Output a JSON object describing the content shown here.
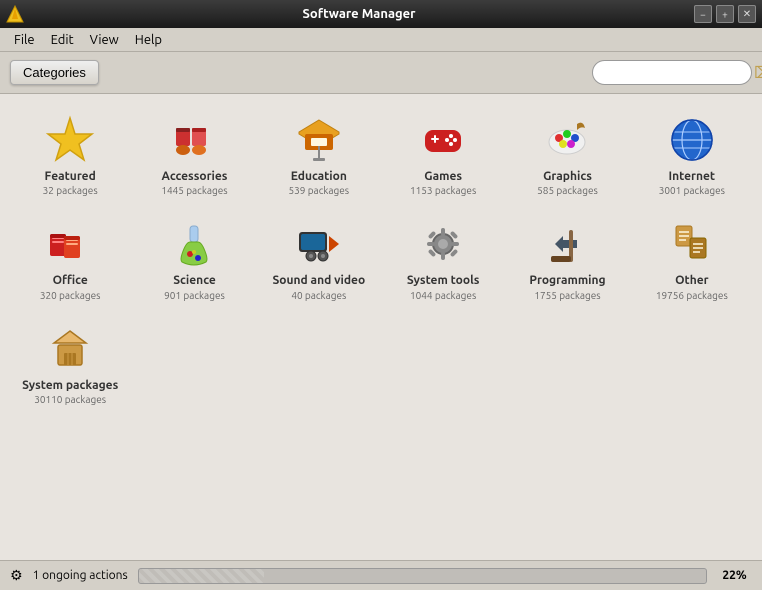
{
  "window": {
    "title": "Software Manager",
    "controls": {
      "minimize": "−",
      "maximize": "+",
      "close": "✕"
    }
  },
  "menu": {
    "items": [
      "File",
      "Edit",
      "View",
      "Help"
    ]
  },
  "toolbar": {
    "categories_label": "Categories",
    "search_placeholder": ""
  },
  "categories": [
    {
      "id": "featured",
      "name": "Featured",
      "count": "32 packages",
      "color": "#e8a020"
    },
    {
      "id": "accessories",
      "name": "Accessories",
      "count": "1445 packages",
      "color": "#cc3030"
    },
    {
      "id": "education",
      "name": "Education",
      "count": "539 packages",
      "color": "#cc6600"
    },
    {
      "id": "games",
      "name": "Games",
      "count": "1153 packages",
      "color": "#cc2020"
    },
    {
      "id": "graphics",
      "name": "Graphics",
      "count": "585 packages",
      "color": "#aa5500"
    },
    {
      "id": "internet",
      "name": "Internet",
      "count": "3001 packages",
      "color": "#2255cc"
    },
    {
      "id": "office",
      "name": "Office",
      "count": "320 packages",
      "color": "#cc2020"
    },
    {
      "id": "science",
      "name": "Science",
      "count": "901 packages",
      "color": "#2288cc"
    },
    {
      "id": "sound-video",
      "name": "Sound and video",
      "count": "40 packages",
      "color": "#cc4400"
    },
    {
      "id": "system-tools",
      "name": "System tools",
      "count": "1044 packages",
      "color": "#888888"
    },
    {
      "id": "programming",
      "name": "Programming",
      "count": "1755 packages",
      "color": "#555555"
    },
    {
      "id": "other",
      "name": "Other",
      "count": "19756 packages",
      "color": "#886622"
    },
    {
      "id": "system-packages",
      "name": "System packages",
      "count": "30110 packages",
      "color": "#aa7722"
    }
  ],
  "status_bar": {
    "icon": "⚙",
    "text": "1 ongoing actions",
    "progress": 22,
    "progress_label": "22%"
  }
}
